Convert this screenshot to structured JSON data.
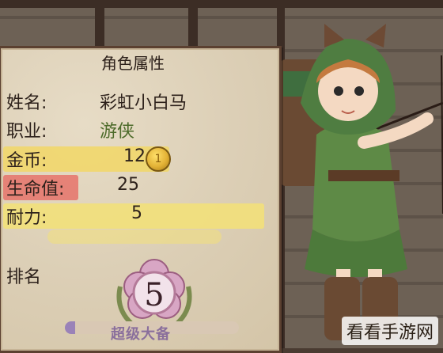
{
  "panel": {
    "title": "角色属性",
    "rows": [
      {
        "label": "姓名:",
        "value": "彩虹小白马"
      },
      {
        "label": "职业:",
        "value": "游侠"
      },
      {
        "label": "金币:",
        "value": "12"
      },
      {
        "label": "生命值:",
        "value": "25"
      },
      {
        "label": "耐力:",
        "value": "5"
      }
    ],
    "coin_symbol": "1",
    "rank_label": "排名",
    "rank_value": "5",
    "rank_title": "超级大备",
    "progress_fraction": 0.06
  },
  "colors": {
    "coin_highlight": "#f1d76b",
    "hp_highlight": "#e5796f",
    "stamina_highlight": "#f2e07a",
    "class_text": "#4d6b2a",
    "badge_pink": "#d8a6c4",
    "laurel_green": "#7b8b4f"
  },
  "watermark": "看看手游网"
}
